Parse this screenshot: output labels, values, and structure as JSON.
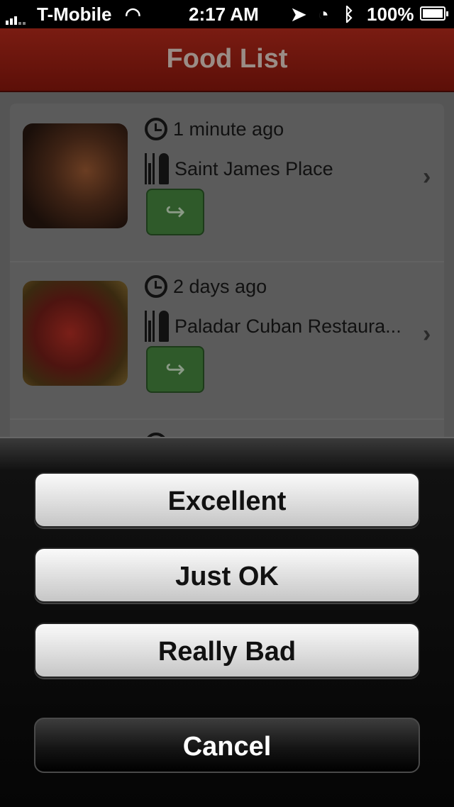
{
  "status_bar": {
    "carrier": "T-Mobile",
    "time": "2:17 AM",
    "battery_percent": "100%",
    "battery_level": 1.0
  },
  "navbar": {
    "title": "Food List"
  },
  "list": {
    "items": [
      {
        "time_ago": "1 minute ago",
        "place": "Saint James Place",
        "photo_icon": "food-photo"
      },
      {
        "time_ago": "2 days ago",
        "place": "Paladar Cuban Restaura...",
        "photo_icon": "food-photo"
      }
    ]
  },
  "action_sheet": {
    "options": [
      "Excellent",
      "Just OK",
      "Really Bad"
    ],
    "cancel_label": "Cancel"
  },
  "colors": {
    "navbar": "#6e1a10",
    "share_button": "#2f5a2a",
    "sheet_background": "#050505"
  }
}
